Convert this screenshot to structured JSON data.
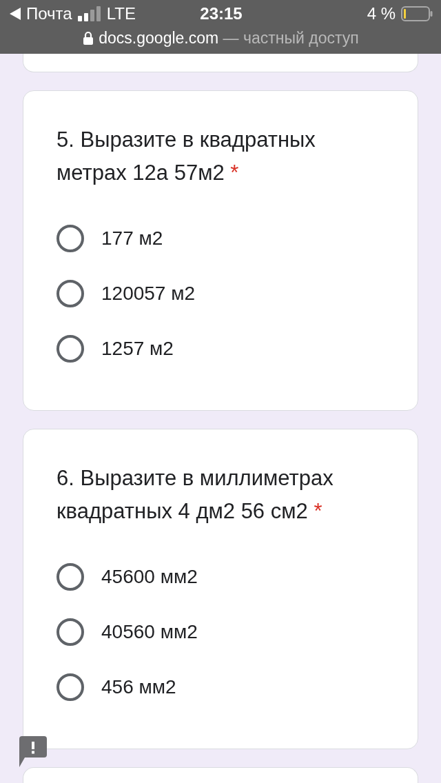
{
  "status_bar": {
    "back_label": "Почта",
    "network": "LTE",
    "time": "23:15",
    "battery": "4 %"
  },
  "address_bar": {
    "domain": "docs.google.com",
    "note": "— частный доступ"
  },
  "questions": [
    {
      "title": "5. Выразите в квадратных метрах 12а 57м2",
      "required_mark": "*",
      "options": [
        {
          "label": "177 м2",
          "selected": false
        },
        {
          "label": "120057 м2",
          "selected": false
        },
        {
          "label": "1257 м2",
          "selected": false
        }
      ]
    },
    {
      "title": "6. Выразите в миллиметрах квадратных 4 дм2 56 см2",
      "required_mark": "*",
      "options": [
        {
          "label": "45600 мм2",
          "selected": false
        },
        {
          "label": "40560 мм2",
          "selected": false
        },
        {
          "label": "456 мм2",
          "selected": false
        }
      ]
    }
  ]
}
